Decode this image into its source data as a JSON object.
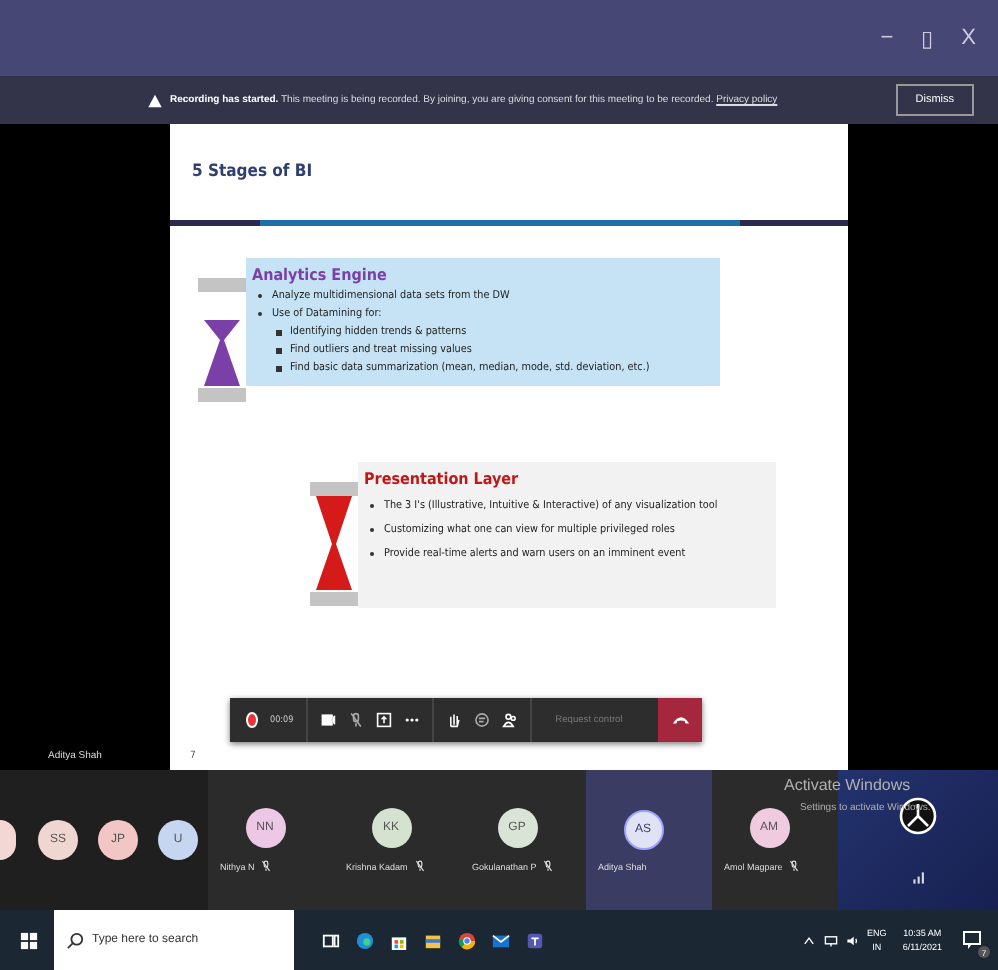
{
  "window": {
    "controls": [
      "−",
      "▯",
      "X"
    ]
  },
  "banner": {
    "bold": "Recording has started.",
    "message": "This meeting is being recorded. By joining, you are giving consent for this meeting to be recorded.",
    "link": "Privacy policy",
    "button": "Dismiss"
  },
  "slide": {
    "title": "5 Stages of BI",
    "page": "7",
    "sections": [
      {
        "kind": "purple",
        "heading": "Analytics Engine",
        "bullets": [
          {
            "text": "Analyze multidimensional data sets from the DW"
          },
          {
            "text": "Use of Datamining for:",
            "children": [
              "Identifying hidden trends & patterns",
              "Find outliers and treat missing values",
              "Find basic data summarization (mean, median, mode, std. deviation, etc.)"
            ]
          }
        ]
      },
      {
        "kind": "red",
        "heading": "Presentation Layer",
        "bullets": [
          {
            "text": "The 3 I's (Illustrative, Intuitive & Interactive) of any visualization tool"
          },
          {
            "text": "Customizing what one can view for multiple privileged roles"
          },
          {
            "text": "Provide real-time alerts and warn users on an imminent event"
          }
        ]
      }
    ]
  },
  "presenter_name": "Aditya Shah",
  "call_toolbar": {
    "recording": true,
    "timer": "00:09",
    "mic_muted": true,
    "request_control": "Request control"
  },
  "participants": [
    {
      "initials": "SS",
      "color": "#f0d6d0",
      "speaking": false
    },
    {
      "initials": "JP",
      "color": "#f3c6c6",
      "speaking": false
    },
    {
      "initials": "U",
      "color": "#c7d6f0",
      "speaking": false
    },
    {
      "initials": "NN",
      "name": "Nithya N",
      "color": "#ecc7e6",
      "speaking": false,
      "muted": true
    },
    {
      "initials": "KK",
      "name": "Krishna Kadam",
      "color": "#d6e2d0",
      "speaking": false,
      "muted": true
    },
    {
      "initials": "GP",
      "name": "Gokulanathan P",
      "color": "#d9e4d6",
      "speaking": false,
      "muted": true
    },
    {
      "initials": "AS",
      "name": "Aditya Shah",
      "color": "#dfe3f3",
      "speaking": true,
      "muted": false
    },
    {
      "initials": "AM",
      "name": "Amol Magpare",
      "color": "#f0cbe0",
      "speaking": false,
      "muted": true
    }
  ],
  "activation": {
    "title": "Activate Windows",
    "message": "Settings to activate Windows."
  },
  "taskbar": {
    "search_placeholder": "Type here to search",
    "language": "ENG",
    "region": "IN",
    "time": "10:35 AM",
    "date": "6/11/2021",
    "notifications": "7"
  }
}
